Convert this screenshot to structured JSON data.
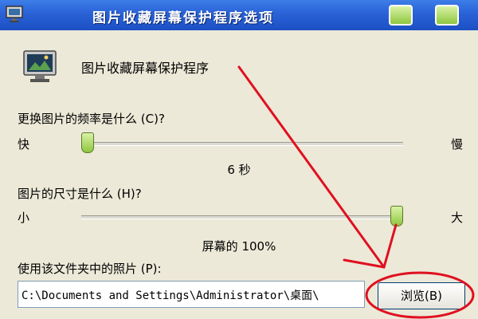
{
  "window": {
    "title": "图片收藏屏幕保护程序选项"
  },
  "header": {
    "program_name": "图片收藏屏幕保护程序"
  },
  "frequency": {
    "label": "更换图片的频率是什么 (C)?",
    "min_label": "快",
    "max_label": "慢",
    "value_text": "6 秒",
    "slider_position": 0.0
  },
  "size": {
    "label": "图片的尺寸是什么 (H)?",
    "min_label": "小",
    "max_label": "大",
    "value_text": "屏幕的 100%",
    "slider_position": 1.0
  },
  "folder": {
    "label": "使用该文件夹中的照片 (P):",
    "path_value": "C:\\Documents and Settings\\Administrator\\桌面\\",
    "browse_label": "浏览(B)"
  },
  "colors": {
    "titlebar": "#2b64d8",
    "dialog_bg": "#ece9d8",
    "annotation": "#e01020"
  }
}
